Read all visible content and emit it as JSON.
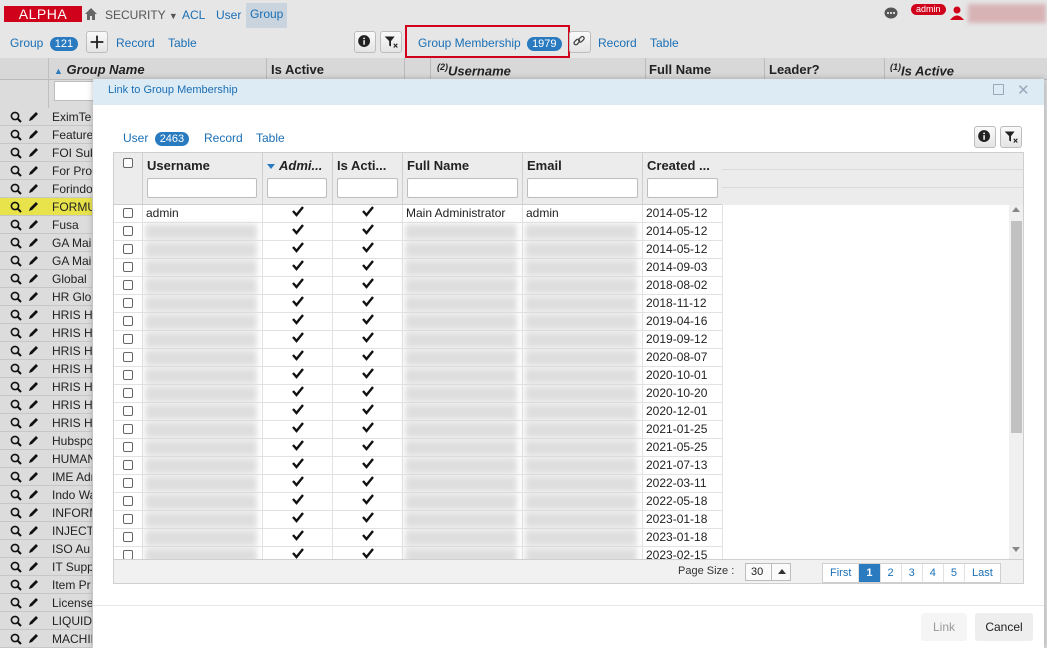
{
  "topbar": {
    "logo": "ALPHA",
    "security_menu": "SECURITY",
    "acl": "ACL",
    "user": "User",
    "group": "Group",
    "admin_badge": "admin"
  },
  "toolbar": {
    "group_label": "Group",
    "group_count": "121",
    "record": "Record",
    "table": "Table",
    "membership_label": "Group Membership",
    "membership_count": "1979",
    "record2": "Record",
    "table2": "Table"
  },
  "bg_grid": {
    "headers": [
      "Group Name",
      "Is Active",
      "Username",
      "Full Name",
      "Leader?",
      "Is Active"
    ],
    "header_prefix_username": "(2)",
    "header_prefix_active": "(1)",
    "rows": [
      "EximTe",
      "Feature",
      "FOI Sub",
      "For Pro",
      "Forindo",
      "FORMU",
      "Fusa",
      "GA Mai",
      "GA Mai",
      "Global",
      "HR Glo",
      "HRIS H",
      "HRIS H",
      "HRIS H",
      "HRIS H",
      "HRIS H",
      "HRIS H",
      "HRIS H",
      "Hubspo",
      "HUMAN",
      "IME Adr",
      "Indo Wa",
      "INFORM",
      "INJECT",
      "ISO Au",
      "IT Supp",
      "Item Pr",
      "License",
      "LIQUID",
      "MACHIN"
    ]
  },
  "modal": {
    "title": "Link to Group Membership",
    "user_label": "User",
    "user_count": "2463",
    "record": "Record",
    "table": "Table",
    "columns": [
      "Username",
      "Admi...",
      "Is Acti...",
      "Full Name",
      "Email",
      "Created ..."
    ],
    "rows": [
      {
        "username": "admin",
        "full_name": "Main Administrator",
        "email": "admin",
        "created": "2014-05-12"
      },
      {
        "username": "",
        "full_name": "",
        "email": "",
        "created": "2014-05-12"
      },
      {
        "username": "",
        "full_name": "",
        "email": "",
        "created": "2014-05-12"
      },
      {
        "username": "",
        "full_name": "",
        "email": "",
        "created": "2014-09-03"
      },
      {
        "username": "",
        "full_name": "",
        "email": "",
        "created": "2018-08-02"
      },
      {
        "username": "",
        "full_name": "",
        "email": "",
        "created": "2018-11-12"
      },
      {
        "username": "",
        "full_name": "",
        "email": "",
        "created": "2019-04-16"
      },
      {
        "username": "",
        "full_name": "",
        "email": "",
        "created": "2019-09-12"
      },
      {
        "username": "",
        "full_name": "",
        "email": "",
        "created": "2020-08-07"
      },
      {
        "username": "",
        "full_name": "",
        "email": "",
        "created": "2020-10-01"
      },
      {
        "username": "",
        "full_name": "",
        "email": "",
        "created": "2020-10-20"
      },
      {
        "username": "",
        "full_name": "",
        "email": "",
        "created": "2020-12-01"
      },
      {
        "username": "",
        "full_name": "",
        "email": "",
        "created": "2021-01-25"
      },
      {
        "username": "",
        "full_name": "",
        "email": "",
        "created": "2021-05-25"
      },
      {
        "username": "",
        "full_name": "",
        "email": "",
        "created": "2021-07-13"
      },
      {
        "username": "",
        "full_name": "",
        "email": "",
        "created": "2022-03-11"
      },
      {
        "username": "",
        "full_name": "",
        "email": "",
        "created": "2022-05-18"
      },
      {
        "username": "",
        "full_name": "",
        "email": "",
        "created": "2023-01-18"
      },
      {
        "username": "",
        "full_name": "",
        "email": "",
        "created": "2023-01-18"
      },
      {
        "username": "",
        "full_name": "",
        "email": "",
        "created": "2023-02-15"
      }
    ],
    "page_size_label": "Page Size :",
    "page_size": "30",
    "pages": [
      "First",
      "1",
      "2",
      "3",
      "4",
      "5",
      "Last"
    ],
    "active_page": "1",
    "btn_link": "Link",
    "btn_cancel": "Cancel"
  },
  "colors": {
    "accent": "#2a7ac0",
    "logo_red": "#d0021b",
    "highlight_row": "#e8e34a",
    "modal_header": "#ddebf5"
  }
}
